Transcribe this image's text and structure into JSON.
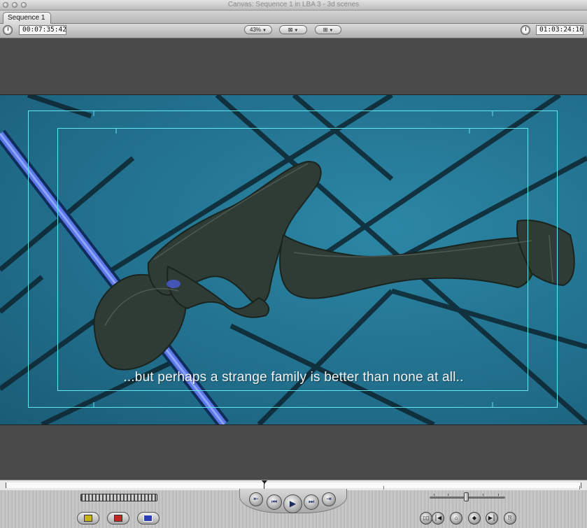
{
  "window": {
    "title": "Canvas: Sequence 1 in LBA 3 - 3d scenes"
  },
  "tabs": [
    {
      "label": "Sequence 1",
      "active": true
    }
  ],
  "toolbar": {
    "duration_timecode": "00:07:35:42",
    "zoom_label": "43%",
    "view_icon": "view-mode-icon",
    "overlay_icon": "overlay-icon",
    "current_timecode": "01:03:24:16"
  },
  "canvas": {
    "subtitle": "...but perhaps a strange family is better than none at all.."
  },
  "transport": {
    "buttons": [
      {
        "name": "play-in-to-out-icon"
      },
      {
        "name": "previous-edit-icon"
      },
      {
        "name": "play-icon"
      },
      {
        "name": "next-edit-icon"
      },
      {
        "name": "play-around-icon"
      }
    ],
    "edit_buttons": [
      {
        "name": "insert-edit-icon",
        "color": "#c9b21c"
      },
      {
        "name": "overwrite-edit-icon",
        "color": "#c42626"
      },
      {
        "name": "replace-edit-icon",
        "color": "#2d3fb4"
      }
    ],
    "mark_buttons": [
      {
        "name": "match-frame-icon"
      },
      {
        "name": "mark-clip-icon"
      },
      {
        "name": "add-marker-icon"
      },
      {
        "name": "add-keyframe-icon"
      },
      {
        "name": "mark-in-icon"
      },
      {
        "name": "mark-out-icon"
      }
    ]
  },
  "colors": {
    "title_safe": "#5fe8ef",
    "video_background": "#1f6a87"
  }
}
